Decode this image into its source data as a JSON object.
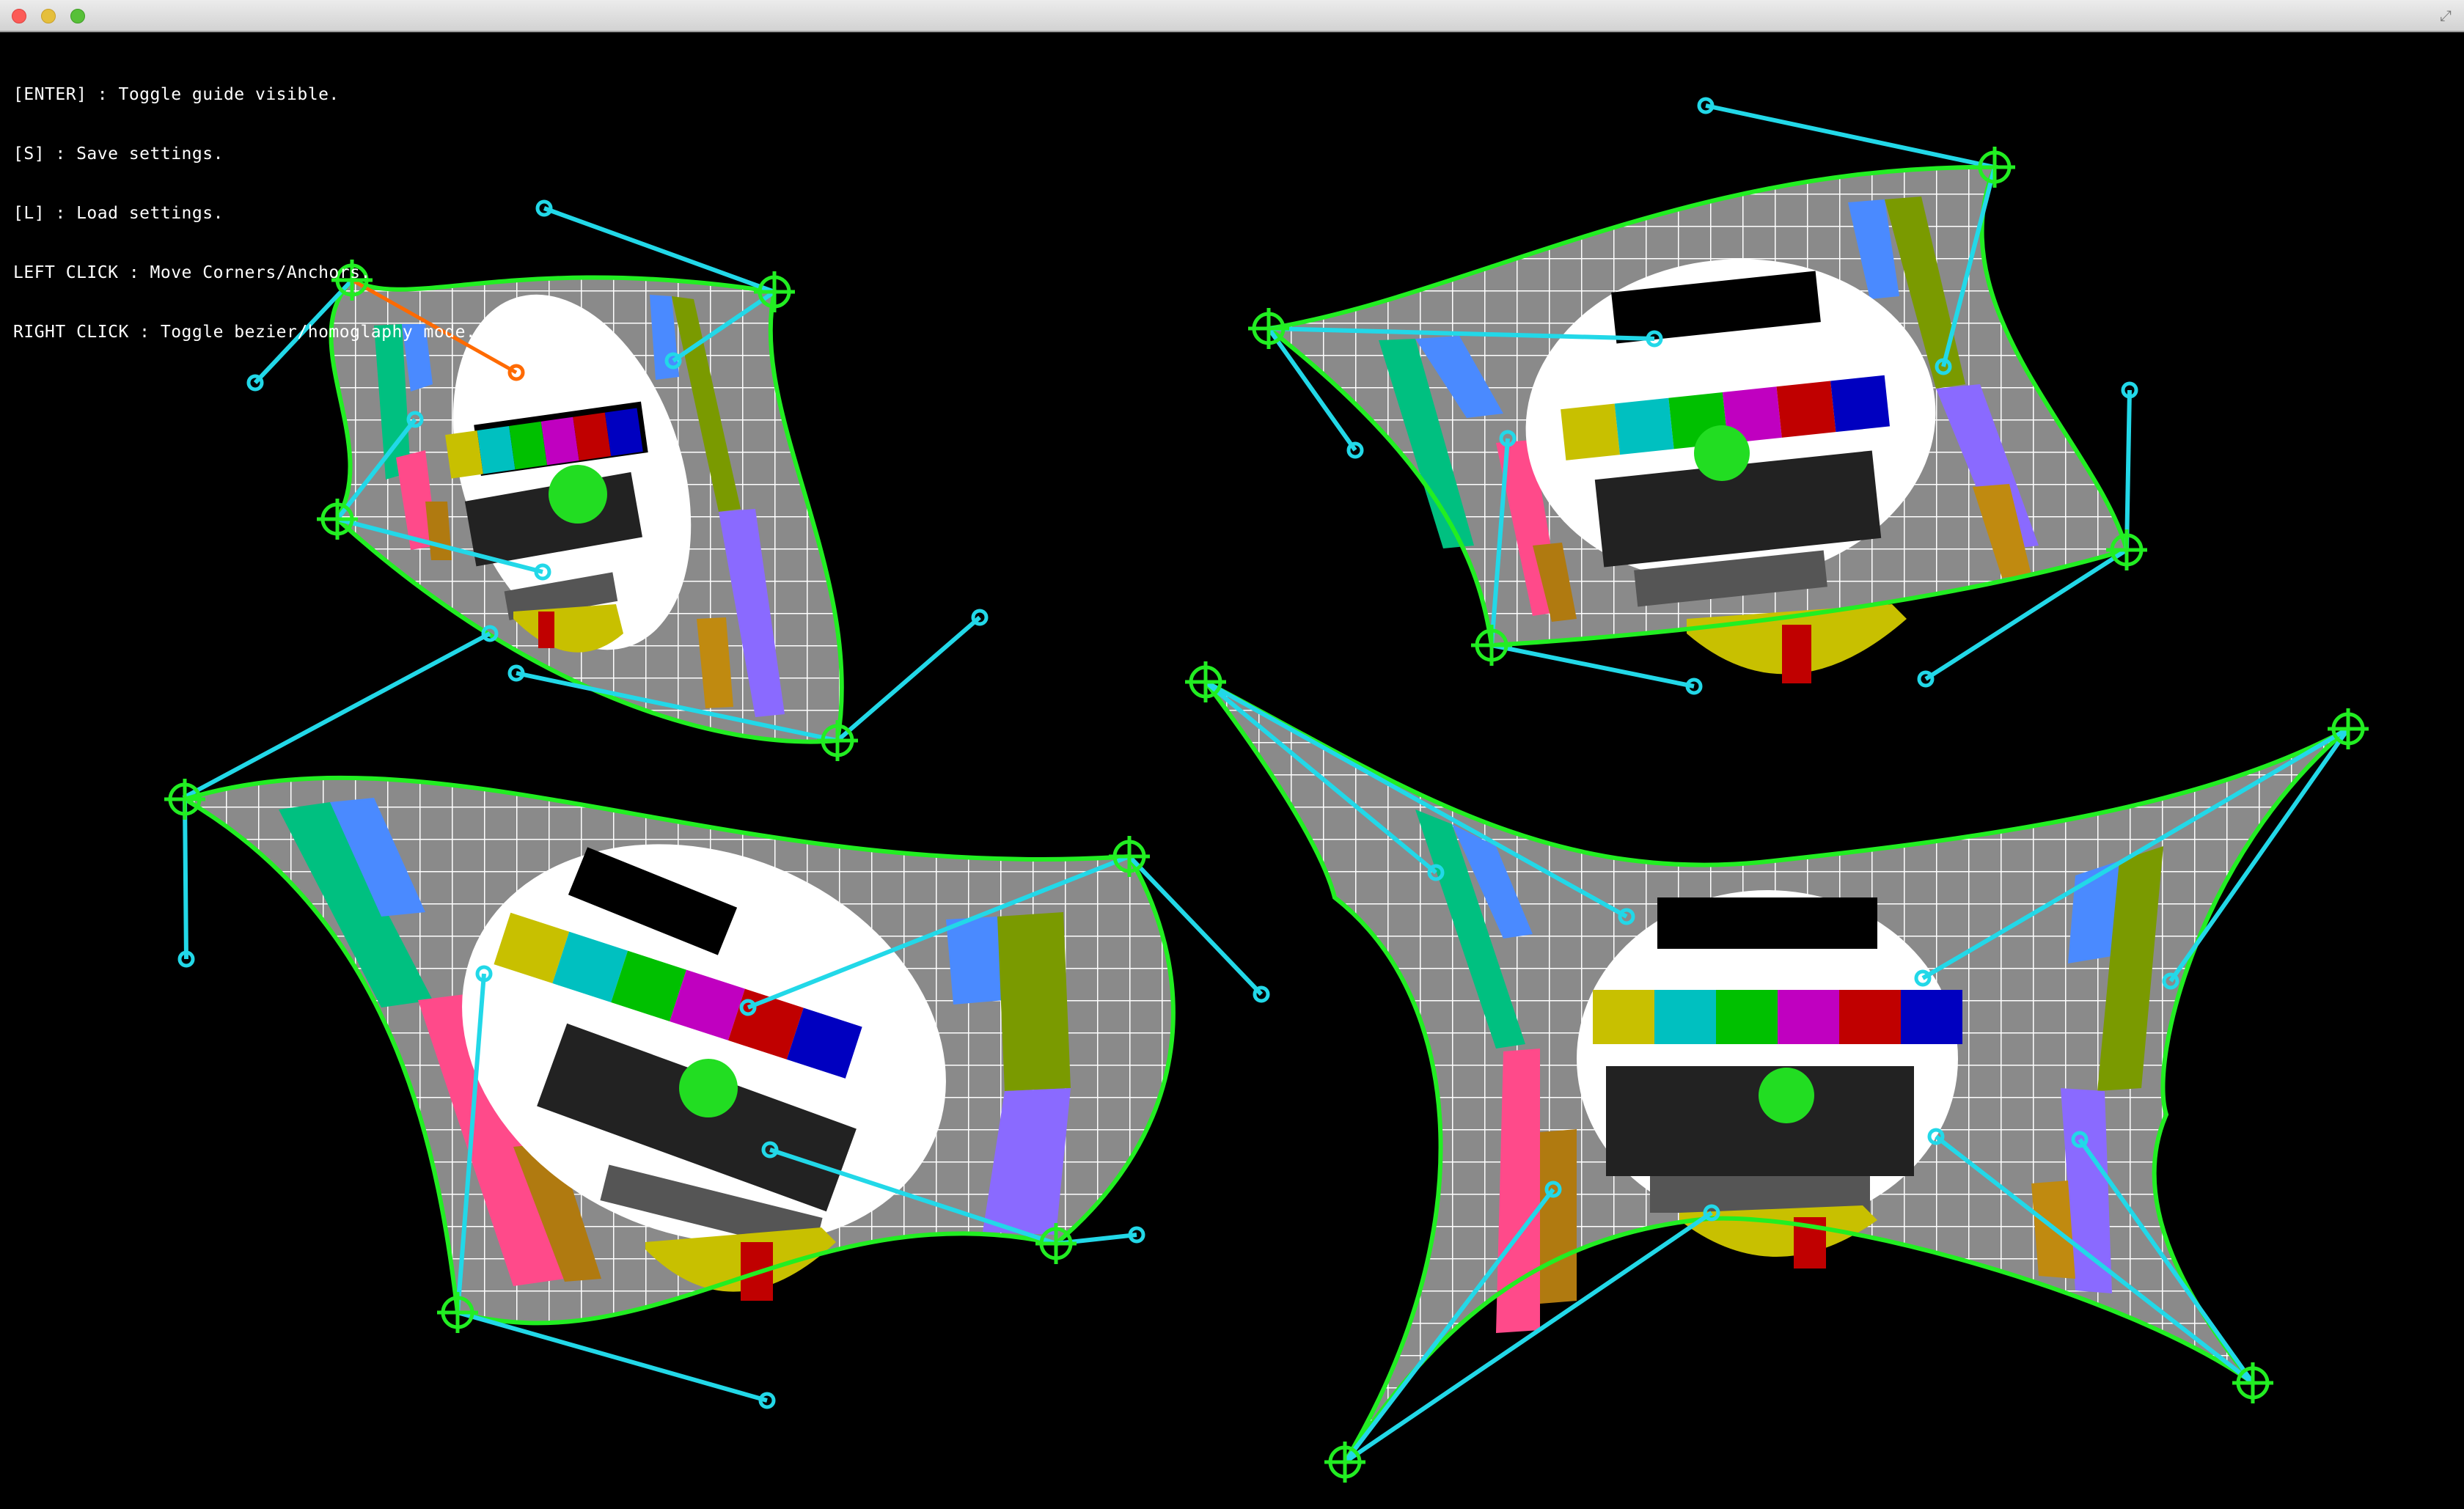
{
  "window": {
    "title": "",
    "buttons": [
      "close",
      "minimize",
      "zoom"
    ]
  },
  "help": {
    "lines": [
      "[ENTER] : Toggle guide visible.",
      "[S] : Save settings.",
      "[L] : Load settings.",
      "LEFT CLICK : Move Corners/Anchors.",
      "RIGHT CLICK : Toggle bezier/homoglaphy mode."
    ]
  },
  "colors": {
    "background": "#000000",
    "outline": "#22ee22",
    "handle_line": "#22d8e8",
    "selected_handle": "#ff6a00",
    "grid_gray": "#8a8a8a",
    "grid_line": "#ffffff"
  },
  "scene": {
    "warped_surfaces": 4,
    "corner_marker_icon": "crosshair-circle-icon",
    "anchor_marker_icon": "small-circle-icon"
  }
}
